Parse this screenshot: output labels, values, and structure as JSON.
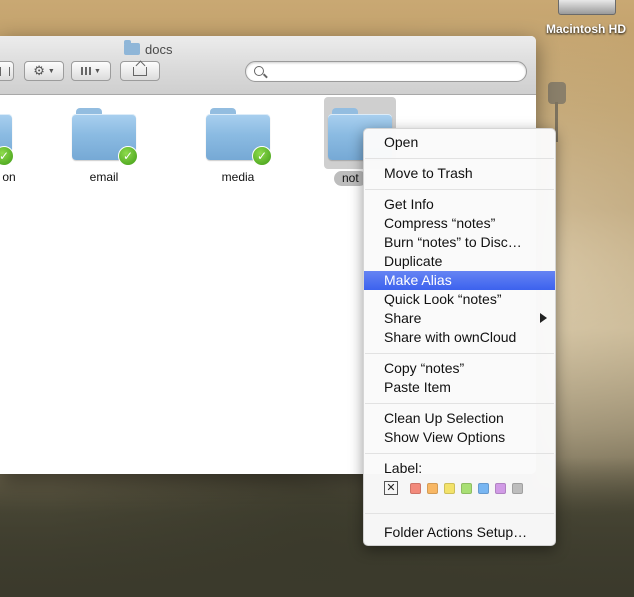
{
  "desktop": {
    "hard_drive_label": "Macintosh HD"
  },
  "finder": {
    "title": "docs",
    "search": {
      "value": "",
      "placeholder": ""
    },
    "items": [
      {
        "label": "on",
        "synced": true
      },
      {
        "label": "email",
        "synced": true
      },
      {
        "label": "media",
        "synced": true
      },
      {
        "label": "notes",
        "synced": true,
        "selected": true,
        "visible_label": "not"
      }
    ]
  },
  "context_menu": {
    "open": "Open",
    "move_to_trash": "Move to Trash",
    "get_info": "Get Info",
    "compress": "Compress “notes”",
    "burn": "Burn “notes” to Disc…",
    "duplicate": "Duplicate",
    "make_alias": "Make Alias",
    "quick_look": "Quick Look “notes”",
    "share": "Share",
    "share_owncloud": "Share with ownCloud",
    "copy": "Copy “notes”",
    "paste": "Paste Item",
    "clean_up": "Clean Up Selection",
    "view_options": "Show View Options",
    "label": "Label:",
    "label_none_glyph": "✕",
    "label_colors": [
      "#f2897b",
      "#f8b764",
      "#f3e26a",
      "#a8df74",
      "#78b6f2",
      "#d19be6",
      "#bdbdbd"
    ],
    "folder_actions": "Folder Actions Setup…",
    "highlighted": "make_alias"
  },
  "colors": {
    "highlight": "#3c62ee",
    "sync_badge": "#4caf1e"
  },
  "icons": {
    "check": "✓"
  }
}
